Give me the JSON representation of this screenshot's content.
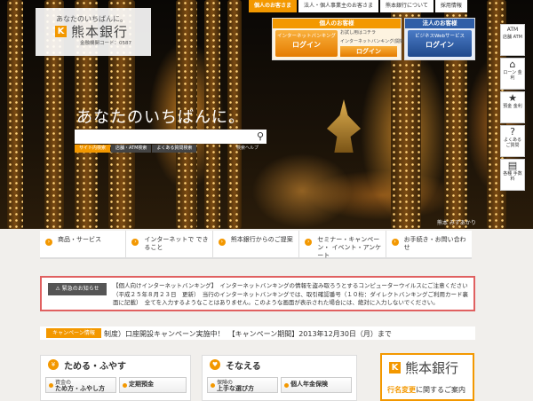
{
  "brand": {
    "tagline": "あなたのいちばんに。",
    "name": "熊本銀行",
    "mark": "K",
    "code": "金融機関コード：0587",
    "accent": "#f39800",
    "corporate_blue": "#2f5ea7"
  },
  "topnav": [
    "個人のお客さま",
    "法人・個人事業主のお客さま",
    "熊本銀行について",
    "採用情報"
  ],
  "login": {
    "personal": {
      "title": "個人のお客様",
      "button_line1": "インターネットバンキング",
      "button_line2": "ログイン",
      "note1": "お試し用はコチラ",
      "note2": "インターネットバンキング(開始用)",
      "sub_button": "ログイン"
    },
    "corporate": {
      "title": "法人のお客様",
      "button_line1": "ビジネスWebサービス",
      "button_line2": "ログイン"
    }
  },
  "side": [
    {
      "icon": "ATM",
      "label": "店舗 ATM"
    },
    {
      "icon": "⌂",
      "label": "ローン 金利"
    },
    {
      "icon": "★",
      "label": "預金 金利"
    },
    {
      "icon": "?",
      "label": "よくある ご質問"
    },
    {
      "icon": "▤",
      "label": "各種 手数料"
    }
  ],
  "hero": {
    "catch": "あなたのいちばんに。",
    "credit": "熊本 みずあかり"
  },
  "search": {
    "tabs": [
      "サイト内検索",
      "店舗・ATM検索",
      "よくある質問検索"
    ],
    "help": "検索ヘルプ"
  },
  "mainnav": [
    "商品・サービス",
    "インターネットで できること",
    "熊本銀行からのご提案",
    "セミナー・キャンペーン・ イベント・アンケート",
    "お手続き・お問い合わせ"
  ],
  "emergency": {
    "label": "緊急のお知らせ",
    "text": "【個人向けインターネットバンキング】　インターネットバンキングの情報を盗み取ろうとするコンピューターウイルスにご注意ください（平成２５年８月２３日　更新）　当行のインターネットバンキングでは、取引確認番号（１０桁：ダイレクトバンキングご利用カード裏面に記載）　全てを入力するようなことはありません。このような画面が表示された場合には、絶対に入力しないでください。"
  },
  "ticker": {
    "label": "キャンペーン情報",
    "text": "制度）口座開設キャンペーン実施中！　【キャンペーン期間】2013年12月30日（月）まで"
  },
  "panels": {
    "save": {
      "icon": "¥",
      "title": "ためる・ふやす",
      "btn1_small": "資金の",
      "btn1_big": "ため方・ふやし方",
      "btn2": "定期預金"
    },
    "prepare": {
      "icon": "♥",
      "title": "そなえる",
      "btn1_small": "保険の",
      "btn1_big": "上手な選び方",
      "btn2": "個人年金保険"
    }
  },
  "namechange": {
    "mark": "K",
    "name": "熊本銀行",
    "sub_bold": "行名変更",
    "sub_rest": "に関するご案内"
  }
}
